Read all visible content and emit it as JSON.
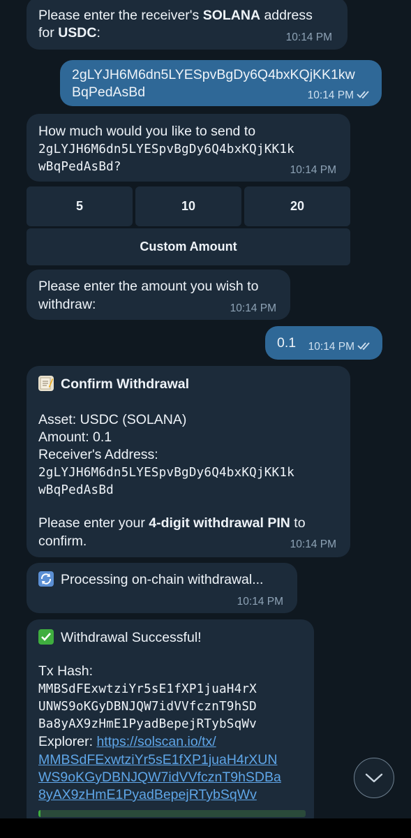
{
  "messages": {
    "m1": {
      "pre": "Please enter the receiver's ",
      "chain": "SOLANA",
      "mid": " address",
      "line2_pre": "for ",
      "asset": "USDC",
      "line2_post": ":",
      "time": "10:14 PM"
    },
    "m2": {
      "line1": "2gLYJH6M6dn5LYESpvBgDy6Q4bxKQjKK1kw",
      "line2": "BqPedAsBd",
      "time": "10:14 PM"
    },
    "m3": {
      "line1": "How much would you like to send to",
      "line2": "2gLYJH6M6dn5LYESpvBgDy6Q4bxKQjKK1k",
      "line3": "wBqPedAsBd?",
      "time": "10:14 PM"
    },
    "m4": {
      "line1": "Please enter the amount you wish to",
      "line2": "withdraw:",
      "time": "10:14 PM"
    },
    "m5": {
      "text": "0.1",
      "time": "10:14 PM"
    },
    "m6": {
      "title": "Confirm Withdrawal",
      "asset_line": "Asset: USDC (SOLANA)",
      "amount_line": "Amount: 0.1",
      "receiver_label": "Receiver's Address:",
      "addr1": "2gLYJH6M6dn5LYESpvBgDy6Q4bxKQjKK1k",
      "addr2": "wBqPedAsBd",
      "pin_pre": "Please enter your ",
      "pin_bold": "4-digit withdrawal PIN",
      "pin_post": " to",
      "pin_line2": "confirm.",
      "time": "10:14 PM"
    },
    "m7": {
      "text": "Processing on-chain withdrawal...",
      "time": "10:14 PM"
    },
    "m8": {
      "title": "Withdrawal Successful!",
      "tx_label": "Tx Hash:",
      "hash1": "MMBSdFExwtziYr5sE1fXP1juaH4rX",
      "hash2": "UNWS9oKGyDBNJQW7idVVfcznT9hSD",
      "hash3": "Ba8yAX9zHmE1PyadBepejRTybSqWv",
      "explorer_label": "Explorer: ",
      "link1": "https://solscan.io/tx/",
      "link2": "MMBSdFExwtziYr5sE1fXP1juaH4rXUN",
      "link3": "WS9oKGyDBNJQW7idVVfcznT9hSDBa",
      "link4": "8yAX9zHmE1PyadBepejRTybSqWv"
    }
  },
  "keyboard": {
    "amount_5": "5",
    "amount_10": "10",
    "amount_20": "20",
    "custom": "Custom Amount"
  },
  "icons": {
    "confirm": "memo-icon",
    "processing": "arrows-cycle-icon",
    "success": "check-mark-icon",
    "scroll": "chevron-down-icon"
  },
  "colors": {
    "incoming": "#1c2b3a",
    "outgoing": "#2f6897",
    "link": "#5fa6e8",
    "success_green": "#3fae3f"
  }
}
